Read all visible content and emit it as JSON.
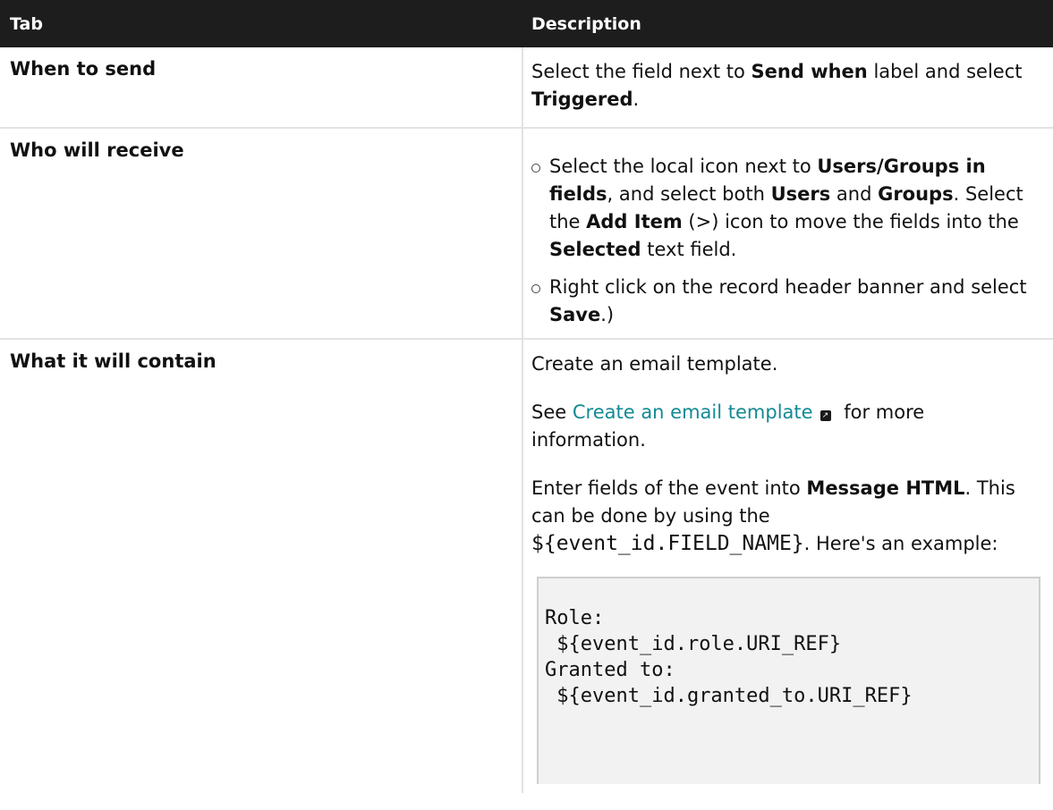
{
  "header": {
    "col_tab": "Tab",
    "col_description": "Description"
  },
  "rows": [
    {
      "tab": "When to send",
      "desc": {
        "t1": "Select the field next to ",
        "b1": "Send when",
        "t2": " label and select ",
        "b2": "Triggered",
        "t3": "."
      }
    },
    {
      "tab": "Who will receive",
      "bullets": [
        {
          "t1": "Select the local icon next to ",
          "b1": "Users/Groups in fields",
          "t2": ", and select both ",
          "b2": "Users",
          "t3": " and ",
          "b3": "Groups",
          "t4": ". Select the ",
          "b4": "Add Item",
          "t5": " (>) icon to move the fields into the ",
          "b5": "Selected",
          "t6": " text field."
        },
        {
          "t1": "Right click on the record header banner and select ",
          "b1": "Save",
          "t2": ".)"
        }
      ]
    },
    {
      "tab": "What it will contain",
      "p1": "Create an email template.",
      "p2": {
        "t1": "See ",
        "link": "Create an email template",
        "t2": " for more information."
      },
      "p3": {
        "t1": "Enter fields of the event into ",
        "b1": "Message HTML",
        "t2": ". This can be done by using the ",
        "code": "${event_id.FIELD_NAME}",
        "t3": ". Here's an example:"
      },
      "code_block": "Role:\n ${event_id.role.URI_REF}\nGranted to:\n ${event_id.granted_to.URI_REF}"
    }
  ],
  "icons": {
    "external_link": "external-link-icon",
    "bullet": "hollow-circle-bullet"
  },
  "colors": {
    "header_bg": "#1d1d1d",
    "link": "#138995",
    "code_bg": "#f2f2f2"
  }
}
